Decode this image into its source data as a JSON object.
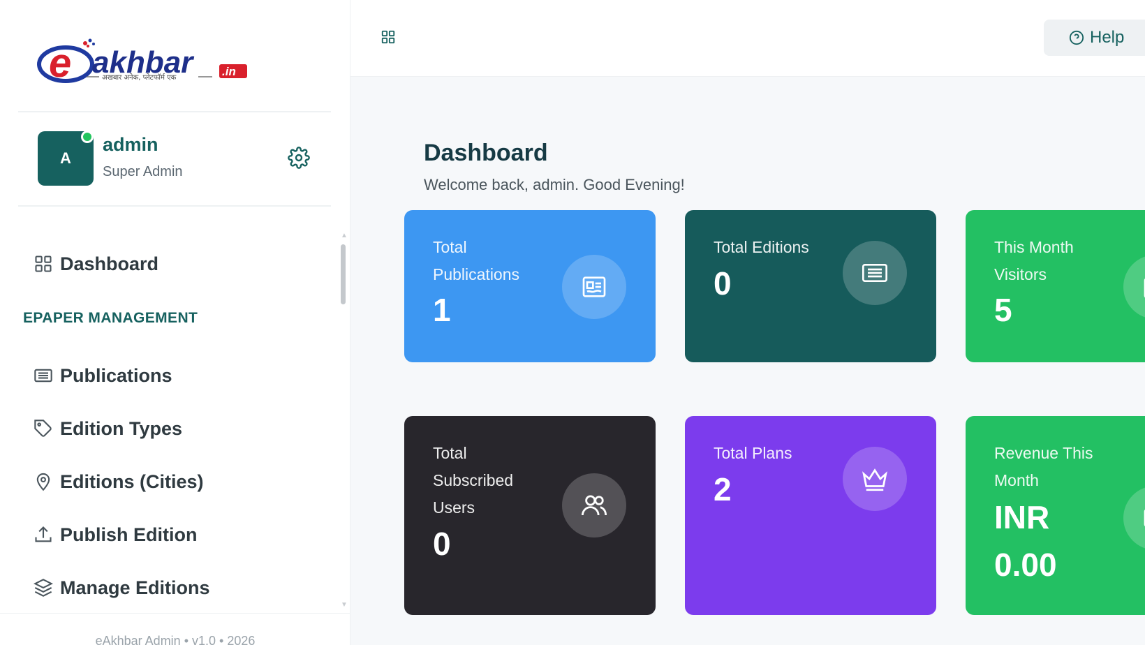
{
  "brand": {
    "logo_text": "akhbar",
    "logo_suffix": ".in",
    "logo_tagline": "अखबार अनेक, प्लेटफॉर्म एक"
  },
  "profile": {
    "avatar_letter": "A",
    "name": "admin",
    "role": "Super Admin"
  },
  "nav": {
    "dashboard": "Dashboard",
    "section": "EPAPER MANAGEMENT",
    "publications": "Publications",
    "edition_types": "Edition Types",
    "editions_cities": "Editions (Cities)",
    "publish_edition": "Publish Edition",
    "manage_editions": "Manage Editions"
  },
  "footer": "eAkhbar Admin • v1.0 • 2026",
  "topbar": {
    "help_label": "Help"
  },
  "page": {
    "title": "Dashboard",
    "subtitle": "Welcome back, admin. Good Evening!"
  },
  "cards": [
    {
      "label_line1": "Total",
      "label_line2": "Publications",
      "value": "1",
      "color": "#3d97f2",
      "icon": "newspaper-icon"
    },
    {
      "label_line1": "Total Editions",
      "value": "0",
      "color": "#165b5b",
      "icon": "list-icon"
    },
    {
      "label_line1": "This Month",
      "label_line2": "Visitors",
      "value": "5",
      "color": "#23c063",
      "icon": "calendar-icon"
    },
    {
      "label_line1": "Total",
      "label_line2": "Subscribed",
      "label_line3": "Users",
      "value": "0",
      "color": "#28262c",
      "icon": "users-icon"
    },
    {
      "label_line1": "Total Plans",
      "value": "2",
      "color": "#7c3ced",
      "icon": "crown-icon"
    },
    {
      "label_line1": "Revenue This",
      "label_line2": "Month",
      "value_line1": "INR",
      "value_line2": "0.00",
      "color": "#23c063",
      "icon": "wallet-icon"
    }
  ]
}
